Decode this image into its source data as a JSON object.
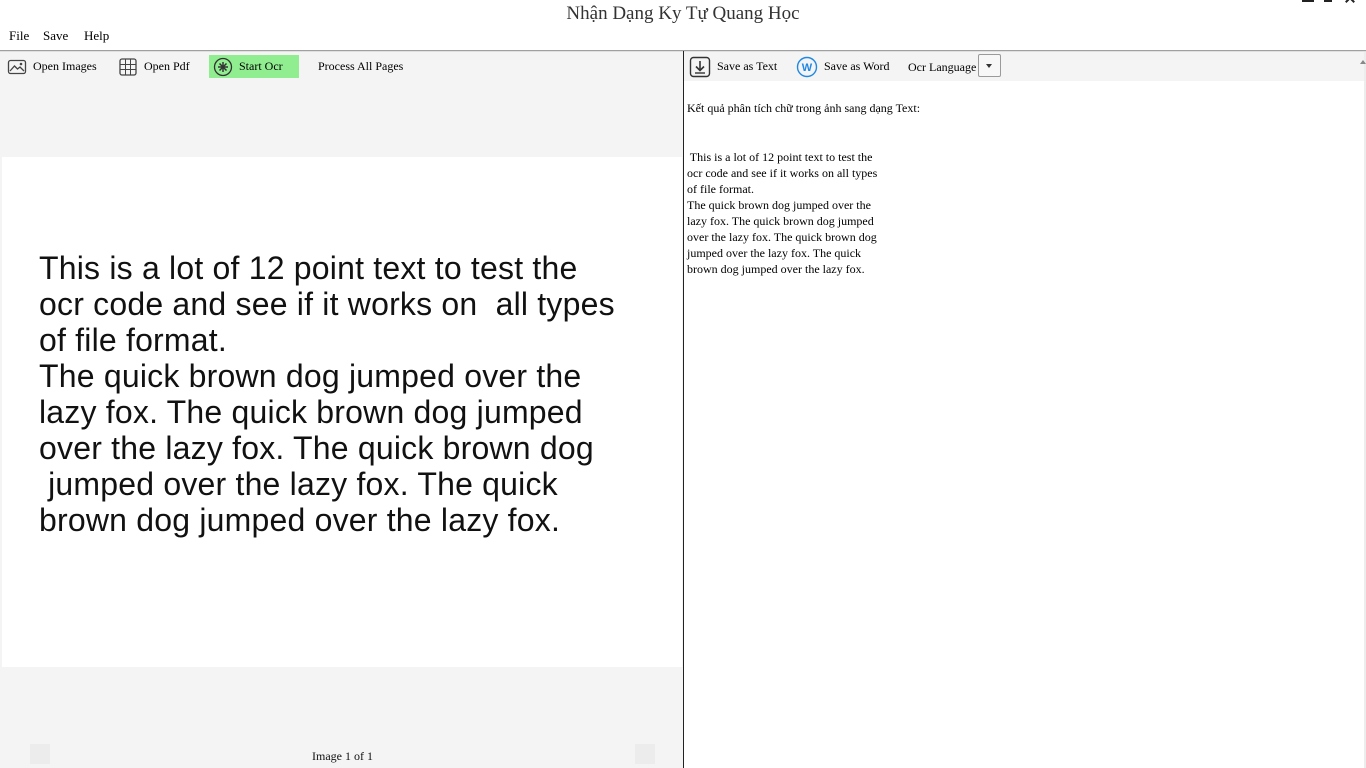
{
  "window": {
    "title": "Nhận Dạng Ky Tự Quang Học"
  },
  "menu": {
    "file": "File",
    "save": "Save",
    "help": "Help"
  },
  "left_toolbar": {
    "open_images": "Open Images",
    "open_pdf": "Open Pdf",
    "start_ocr": "Start Ocr",
    "process_all_pages": "Process All Pages"
  },
  "image_view": {
    "lines": [
      "This is a lot of 12 point text to test the",
      "ocr code and see if it works on  all types",
      "of file format.",
      "The quick brown dog jumped over the",
      "lazy fox. The quick brown dog jumped",
      "over the lazy fox. The quick brown dog",
      " jumped over the lazy fox. The quick",
      "brown dog jumped over the lazy fox."
    ],
    "page_indicator": "Image 1 of 1"
  },
  "right_toolbar": {
    "save_as_text": "Save as Text",
    "save_as_word": "Save as Word",
    "ocr_language": "Ocr Language"
  },
  "result": {
    "heading": "Kết quả phân tích chữ trong ảnh sang dạng Text:",
    "lines": [
      " This is a lot of 12 point text to test the",
      "ocr code and see if it works on all types",
      "of file format.",
      "",
      "The quick brown dog jumped over the",
      "lazy fox. The quick brown dog jumped",
      "over the lazy fox. The quick brown dog",
      "jumped over the lazy fox. The quick",
      "brown dog jumped over the lazy fox."
    ]
  },
  "colors": {
    "start_ocr_bg": "#90ee90",
    "icon_blue": "#1e88e5",
    "panel_bg": "#f4f4f4"
  }
}
